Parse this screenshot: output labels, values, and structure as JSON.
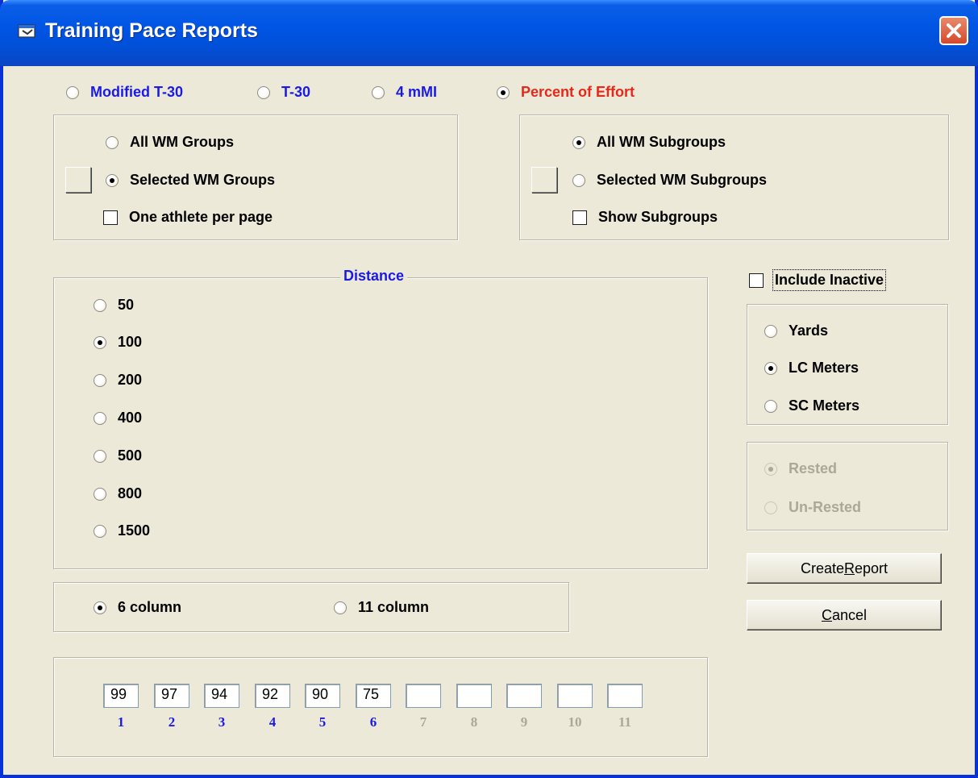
{
  "window": {
    "title": "Training Pace Reports"
  },
  "pace_options": [
    {
      "label": "Modified T-30",
      "selected": false,
      "color": "#1a1ae6"
    },
    {
      "label": "T-30",
      "selected": false,
      "color": "#1a1ae6"
    },
    {
      "label": "4 mMI",
      "selected": false,
      "color": "#1a1ae6"
    },
    {
      "label": "Percent of Effort",
      "selected": true,
      "color": "#e6281a"
    }
  ],
  "groups": {
    "all_label": "All WM Groups",
    "selected_label": "Selected WM Groups",
    "selected": "selected",
    "one_per_page_label": "One athlete per page",
    "one_per_page_checked": false
  },
  "subgroups": {
    "all_label": "All WM Subgroups",
    "selected_label": "Selected WM Subgroups",
    "selected": "all",
    "show_label": "Show Subgroups",
    "show_checked": false
  },
  "distance": {
    "legend": "Distance",
    "options": [
      "50",
      "100",
      "200",
      "400",
      "500",
      "800",
      "1500"
    ],
    "selected": "100"
  },
  "columns": {
    "six_label": "6 column",
    "eleven_label": "11 column",
    "selected": "6"
  },
  "effort_values": [
    {
      "num": "1",
      "value": "99",
      "enabled": true
    },
    {
      "num": "2",
      "value": "97",
      "enabled": true
    },
    {
      "num": "3",
      "value": "94",
      "enabled": true
    },
    {
      "num": "4",
      "value": "92",
      "enabled": true
    },
    {
      "num": "5",
      "value": "90",
      "enabled": true
    },
    {
      "num": "6",
      "value": "75",
      "enabled": true
    },
    {
      "num": "7",
      "value": "",
      "enabled": false
    },
    {
      "num": "8",
      "value": "",
      "enabled": false
    },
    {
      "num": "9",
      "value": "",
      "enabled": false
    },
    {
      "num": "10",
      "value": "",
      "enabled": false
    },
    {
      "num": "11",
      "value": "",
      "enabled": false
    }
  ],
  "include_inactive": {
    "label": "Include Inactive",
    "checked": false
  },
  "course": {
    "options": [
      "Yards",
      "LC Meters",
      "SC Meters"
    ],
    "selected": "LC Meters"
  },
  "rest": {
    "options": [
      "Rested",
      "Un-Rested"
    ],
    "selected": "Rested",
    "enabled": false
  },
  "buttons": {
    "create_pre": "Create ",
    "create_u": "R",
    "create_post": "eport",
    "cancel_u": "C",
    "cancel_post": "ancel"
  },
  "colors": {
    "accent_blue": "#1a1ae6",
    "accent_red": "#e6281a",
    "disabled": "#aca899",
    "titlebar": "#0055e5"
  }
}
